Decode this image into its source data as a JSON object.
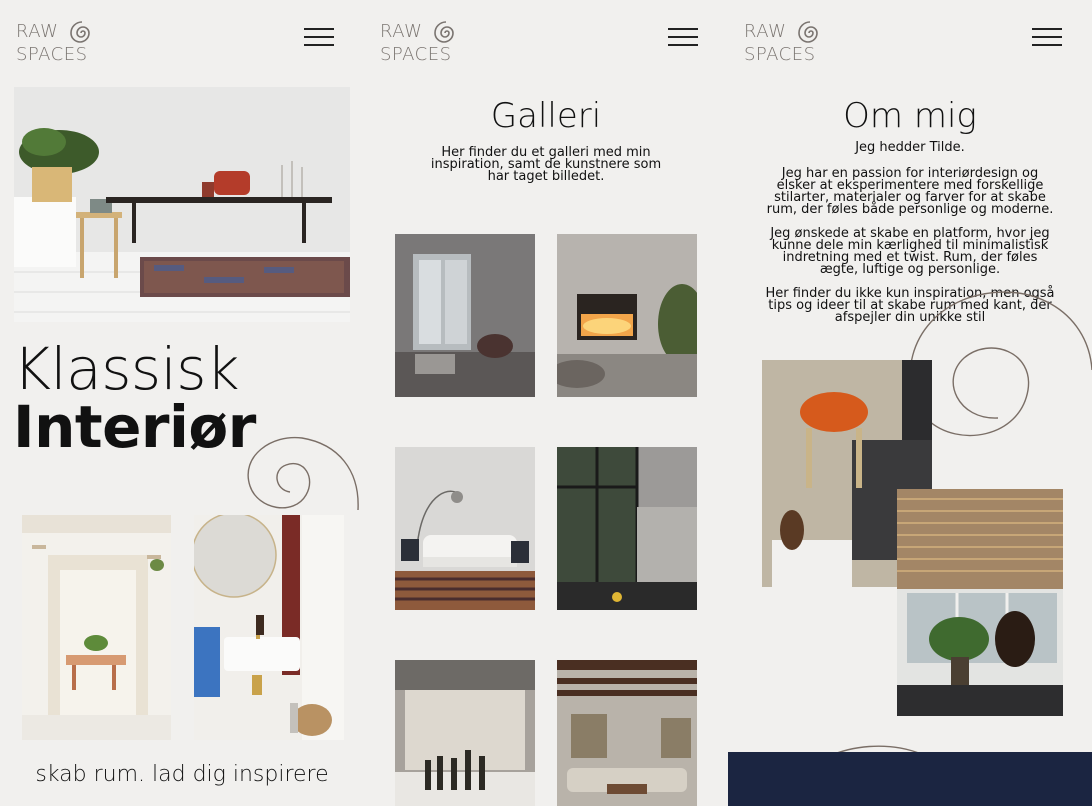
{
  "logo": {
    "line1": "RAW",
    "line2": "SPACES"
  },
  "home": {
    "title_light": "Klassisk",
    "title_bold": "Interiør",
    "tagline": "skab rum. lad dig inspirere"
  },
  "gallery": {
    "title": "Galleri",
    "intro": [
      "Her finder du et galleri med min",
      "inspiration, samt de kunstnere som",
      "har taget billedet."
    ]
  },
  "about": {
    "title": "Om mig",
    "greeting": "Jeg hedder Tilde.",
    "para1": [
      "Jeg har en passion for interiørdesign og",
      "elsker at eksperimentere med forskellige",
      "stilarter, materialer og farver for at skabe",
      "rum, der føles både personlige og moderne."
    ],
    "para2": [
      "Jeg ønskede at skabe en platform, hvor jeg",
      "kunne dele min kærlighed til minimalistisk",
      "indretning med et twist. Rum, der føles",
      "ægte, luftige og personlige."
    ],
    "para3": [
      "Her finder du ikke kun inspiration, men også",
      "tips og ideer til at skabe rum med kant, der",
      "afspejler din unikke stil"
    ]
  },
  "colors": {
    "background": "#f1f0ee",
    "logo": "#7a7470",
    "navy": "#1b2541",
    "deco_line": "#7a6e66"
  }
}
